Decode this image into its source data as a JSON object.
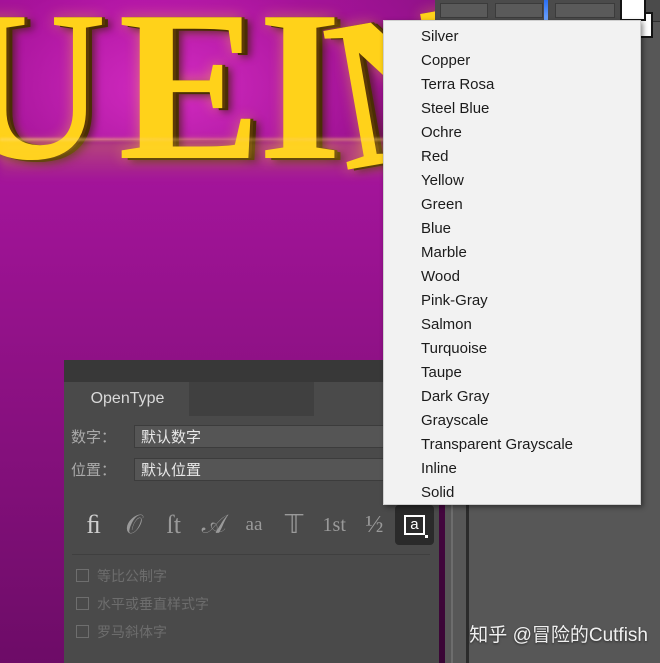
{
  "canvas": {
    "artwork_letters": [
      "U",
      "E",
      "I",
      "N"
    ],
    "background_color": "#9b1192",
    "letter_color": "#ffd21a"
  },
  "top_toolbar": {
    "foreground_swatch_color": "#ffffff",
    "background_swatch_color": "#ffffff",
    "caret_color": "#2a6ff5"
  },
  "preset_dropdown": {
    "items": [
      "Silver",
      "Copper",
      "Terra Rosa",
      "Steel Blue",
      "Ochre",
      "Red",
      "Yellow",
      "Green",
      "Blue",
      "Marble",
      "Wood",
      "Pink-Gray",
      "Salmon",
      "Turquoise",
      "Taupe",
      "Dark Gray",
      "Grayscale",
      "Transparent Grayscale",
      "Inline",
      "Solid"
    ]
  },
  "opentype_panel": {
    "tab_label": "OpenType",
    "rows": [
      {
        "label": "数字：",
        "value": "默认数字"
      },
      {
        "label": "位置：",
        "value": "默认位置"
      }
    ],
    "glyph_buttons": [
      {
        "name": "standard-ligatures-icon",
        "glyph": "ﬁ"
      },
      {
        "name": "alternates-icon",
        "glyph": "𝒪"
      },
      {
        "name": "discretionary-ligatures-icon",
        "glyph": "ſt"
      },
      {
        "name": "swash-icon",
        "glyph": "𝒜"
      },
      {
        "name": "stylistic-alternates-icon",
        "glyph": "aa"
      },
      {
        "name": "titling-alternates-icon",
        "glyph": "𝕋"
      },
      {
        "name": "ordinals-icon",
        "glyph": "1st"
      },
      {
        "name": "fractions-icon",
        "glyph": "½"
      },
      {
        "name": "stylistic-sets-icon",
        "glyph": "a"
      }
    ],
    "checkboxes": [
      {
        "label": "等比公制字",
        "checked": false
      },
      {
        "label": "水平或垂直样式字",
        "checked": false
      },
      {
        "label": "罗马斜体字",
        "checked": false
      }
    ]
  },
  "watermark": {
    "text": "知乎 @冒险的Cutfish"
  }
}
